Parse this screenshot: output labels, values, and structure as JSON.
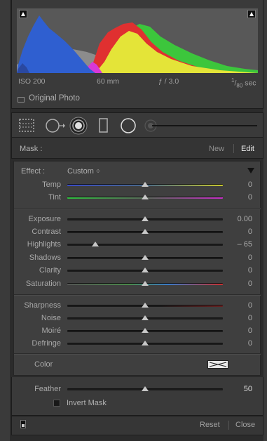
{
  "histogram": {
    "iso": "ISO 200",
    "focal_length": "60 mm",
    "aperture": "ƒ / 3.0",
    "shutter_num": "1",
    "shutter_den": "80",
    "shutter_unit": "sec",
    "original_photo_label": "Original Photo"
  },
  "mask": {
    "label": "Mask :",
    "new_label": "New",
    "edit_label": "Edit"
  },
  "effect": {
    "label": "Effect :",
    "value": "Custom ÷"
  },
  "sliders": [
    {
      "label": "Temp",
      "value": "0",
      "pos": 0.5,
      "track": "temp"
    },
    {
      "label": "Tint",
      "value": "0",
      "pos": 0.5,
      "track": "tint"
    },
    {
      "label": "Exposure",
      "value": "0.00",
      "pos": 0.5,
      "track": "plain"
    },
    {
      "label": "Contrast",
      "value": "0",
      "pos": 0.5,
      "track": "plain"
    },
    {
      "label": "Highlights",
      "value": "– 65",
      "pos": 0.18,
      "track": "plain"
    },
    {
      "label": "Shadows",
      "value": "0",
      "pos": 0.5,
      "track": "plain"
    },
    {
      "label": "Clarity",
      "value": "0",
      "pos": 0.5,
      "track": "plain"
    },
    {
      "label": "Saturation",
      "value": "0",
      "pos": 0.5,
      "track": "sat"
    },
    {
      "label": "Sharpness",
      "value": "0",
      "pos": 0.5,
      "track": "sharp"
    },
    {
      "label": "Noise",
      "value": "0",
      "pos": 0.5,
      "track": "plain"
    },
    {
      "label": "Moiré",
      "value": "0",
      "pos": 0.5,
      "track": "plain"
    },
    {
      "label": "Defringe",
      "value": "0",
      "pos": 0.5,
      "track": "plain"
    }
  ],
  "color": {
    "label": "Color"
  },
  "feather": {
    "label": "Feather",
    "value": "50",
    "pos": 0.5
  },
  "invert_mask": {
    "label": "Invert Mask",
    "checked": false
  },
  "footer": {
    "reset_label": "Reset",
    "close_label": "Close"
  }
}
